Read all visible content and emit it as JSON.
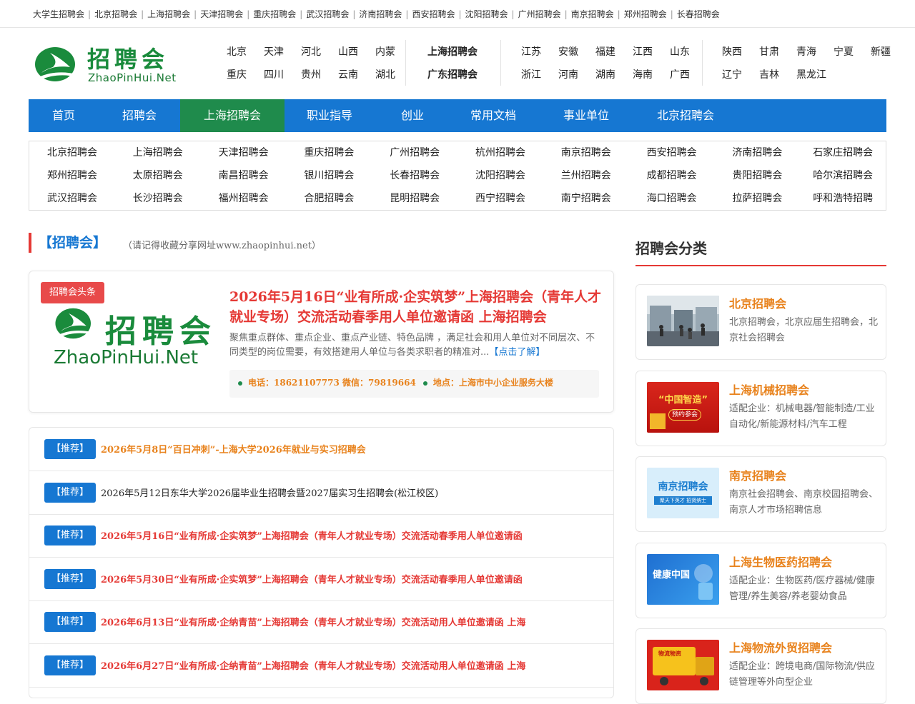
{
  "topbar": {
    "links": [
      "大学生招聘会",
      "北京招聘会",
      "上海招聘会",
      "天津招聘会",
      "重庆招聘会",
      "武汉招聘会",
      "济南招聘会",
      "西安招聘会",
      "沈阳招聘会",
      "广州招聘会",
      "南京招聘会",
      "郑州招聘会",
      "长春招聘会"
    ]
  },
  "logo": {
    "cn": "招聘会",
    "en": "ZhaoPinHui.Net"
  },
  "provinces": {
    "group1": [
      [
        "北京",
        "天津",
        "河北",
        "山西",
        "内蒙"
      ],
      [
        "重庆",
        "四川",
        "贵州",
        "云南",
        "湖北"
      ]
    ],
    "featured": [
      "上海招聘会",
      "广东招聘会"
    ],
    "group2": [
      [
        "江苏",
        "安徽",
        "福建",
        "江西",
        "山东"
      ],
      [
        "浙江",
        "河南",
        "湖南",
        "海南",
        "广西"
      ]
    ],
    "group3": [
      [
        "陕西",
        "甘肃",
        "青海",
        "宁夏",
        "新疆"
      ],
      [
        "辽宁",
        "吉林",
        "黑龙江"
      ]
    ]
  },
  "nav": [
    "首页",
    "招聘会",
    "上海招聘会",
    "职业指导",
    "创业",
    "常用文档",
    "事业单位",
    "北京招聘会"
  ],
  "cities": [
    [
      "北京招聘会",
      "上海招聘会",
      "天津招聘会",
      "重庆招聘会",
      "广州招聘会",
      "杭州招聘会",
      "南京招聘会",
      "西安招聘会",
      "济南招聘会",
      "石家庄招聘会"
    ],
    [
      "郑州招聘会",
      "太原招聘会",
      "南昌招聘会",
      "银川招聘会",
      "长春招聘会",
      "沈阳招聘会",
      "兰州招聘会",
      "成都招聘会",
      "贵阳招聘会",
      "哈尔滨招聘会"
    ],
    [
      "武汉招聘会",
      "长沙招聘会",
      "福州招聘会",
      "合肥招聘会",
      "昆明招聘会",
      "西宁招聘会",
      "南宁招聘会",
      "海口招聘会",
      "拉萨招聘会",
      "呼和浩特招聘"
    ]
  ],
  "section": {
    "title": "【招聘会】",
    "hint": "（请记得收藏分享网址www.zhaopinhui.net）"
  },
  "headline": {
    "badge": "招聘会头条",
    "logo_cn": "招聘会",
    "logo_en": "ZhaoPinHui.Net",
    "title": "2026年5月16日“业有所成·企实筑梦”上海招聘会（青年人才就业专场）交流活动春季用人单位邀请函 上海招聘会",
    "desc": "聚焦重点群体、重点企业、重点产业链、特色品牌 ，满足社会和用人单位对不同层次、不同类型的岗位需要，有效搭建用人单位与各类求职者的精准对...",
    "more": "【点击了解】",
    "phone": "电话：18621107773 微信：79819664",
    "address": "地点：上海市中小企业服务大楼"
  },
  "recommend": {
    "tag": "【推荐】",
    "items": [
      {
        "text": "2026年5月8日“百日冲刺”-上海大学2026年就业与实习招聘会",
        "style": "orange"
      },
      {
        "text": "2026年5月12日东华大学2026届毕业生招聘会暨2027届实习生招聘会(松江校区)",
        "style": "black"
      },
      {
        "text": "2026年5月16日“业有所成·企实筑梦”上海招聘会（青年人才就业专场）交流活动春季用人单位邀请函",
        "style": "red"
      },
      {
        "text": "2026年5月30日“业有所成·企实筑梦”上海招聘会（青年人才就业专场）交流活动春季用人单位邀请函",
        "style": "red"
      },
      {
        "text": "2026年6月13日“业有所成·企纳青苗”上海招聘会（青年人才就业专场）交流活动用人单位邀请函 上海",
        "style": "red"
      },
      {
        "text": "2026年6月27日“业有所成·企纳青苗”上海招聘会（青年人才就业专场）交流活动用人单位邀请函 上海",
        "style": "red"
      }
    ]
  },
  "sidebar": {
    "title": "招聘会分类",
    "cards": [
      {
        "title": "北京招聘会",
        "desc": "北京招聘会，北京应届生招聘会，北京社会招聘会",
        "thumb": "hall-photo",
        "thumb_text": ""
      },
      {
        "title": "上海机械招聘会",
        "desc": "适配企业：机械电器/智能制造/工业自动化/新能源材料/汽车工程",
        "thumb": "china-smart-manufacturing",
        "thumb_text": "“中国智造”",
        "thumb_sub": "预约参会"
      },
      {
        "title": "南京招聘会",
        "desc": "南京社会招聘会、南京校园招聘会、南京人才市场招聘信息",
        "thumb": "nanjing-banner",
        "thumb_text": "南京招聘会",
        "thumb_sub": "聚天下英才 招贤纳士"
      },
      {
        "title": "上海生物医药招聘会",
        "desc": "适配企业：生物医药/医疗器械/健康管理/养生美容/养老婴幼食品",
        "thumb": "health-china",
        "thumb_text": "健康中国"
      },
      {
        "title": "上海物流外贸招聘会",
        "desc": "适配企业：跨境电商/国际物流/供应链管理等外向型企业",
        "thumb": "logistics-truck",
        "thumb_text": "物流物资"
      }
    ]
  }
}
